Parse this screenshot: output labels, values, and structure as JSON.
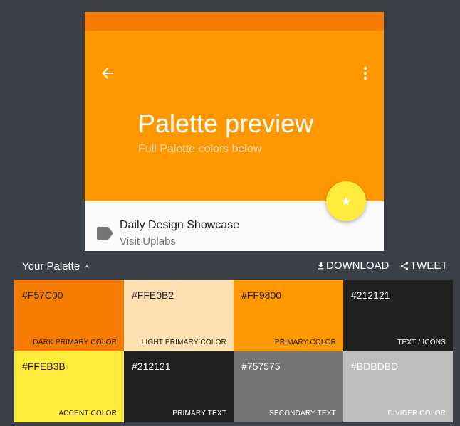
{
  "preview": {
    "title": "Palette preview",
    "subtitle": "Full Palette colors below",
    "list_title": "Daily Design Showcase",
    "list_subtitle": "Visit Uplabs",
    "icons": {
      "back": "arrow-back-icon",
      "menu": "more-vert-icon",
      "fab": "star-icon",
      "list": "label-icon"
    }
  },
  "palette": {
    "title": "Your Palette",
    "download_label": "DOWNLOAD",
    "tweet_label": "TWEET",
    "swatches": [
      {
        "hex": "#F57C00",
        "name": "DARK PRIMARY COLOR",
        "bg": "#f57c00",
        "fg": "#212121"
      },
      {
        "hex": "#FFE0B2",
        "name": "LIGHT PRIMARY COLOR",
        "bg": "#ffe0b2",
        "fg": "#212121"
      },
      {
        "hex": "#FF9800",
        "name": "PRIMARY COLOR",
        "bg": "#ff9800",
        "fg": "#212121"
      },
      {
        "hex": "#212121",
        "name": "TEXT / ICONS",
        "bg": "#212121",
        "fg": "#ffffff"
      },
      {
        "hex": "#FFEB3B",
        "name": "ACCENT COLOR",
        "bg": "#ffeb3b",
        "fg": "#212121"
      },
      {
        "hex": "#212121",
        "name": "PRIMARY TEXT",
        "bg": "#212121",
        "fg": "#ffffff"
      },
      {
        "hex": "#757575",
        "name": "SECONDARY TEXT",
        "bg": "#757575",
        "fg": "#ffffff"
      },
      {
        "hex": "#BDBDBD",
        "name": "DIVIDER COLOR",
        "bg": "#bdbdbd",
        "fg": "#ffffff"
      }
    ]
  }
}
